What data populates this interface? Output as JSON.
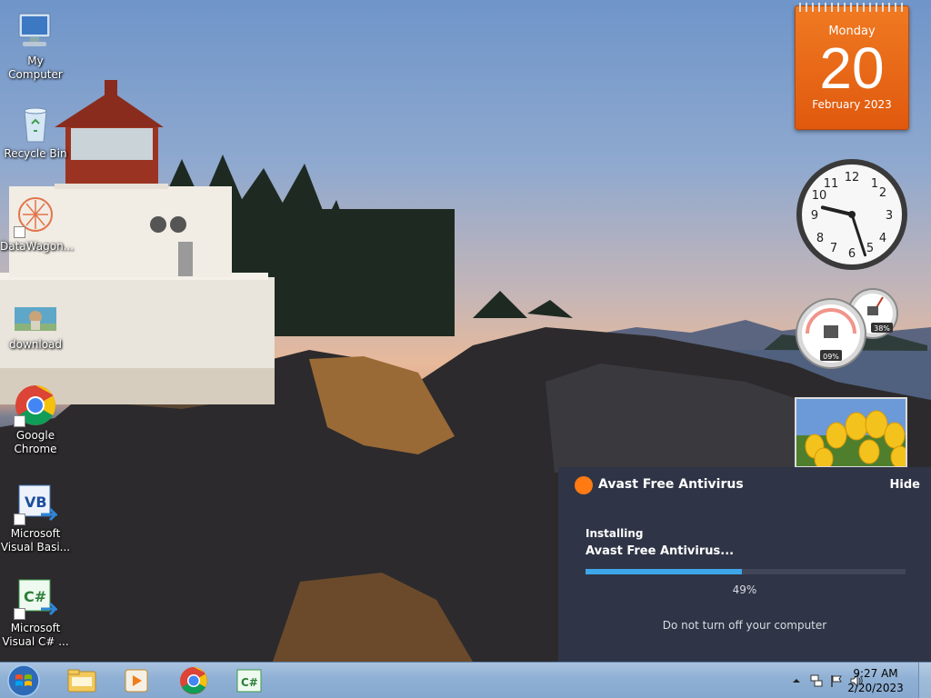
{
  "desktop_icons": [
    {
      "label": "My Computer"
    },
    {
      "label": "Recycle Bin"
    },
    {
      "label": "DataWagon..."
    },
    {
      "label": "download"
    },
    {
      "label": "Google\nChrome"
    },
    {
      "label": "Microsoft\nVisual Basi..."
    },
    {
      "label": "Microsoft\nVisual C# ..."
    }
  ],
  "calendar": {
    "weekday": "Monday",
    "day": "20",
    "month": "February 2023"
  },
  "clock_gadget": {
    "hour": 9,
    "minute": 27
  },
  "meter_gadget": {
    "cpu": "09%",
    "memory": "38%"
  },
  "avast": {
    "title": "Avast Free Antivirus",
    "hide_label": "Hide",
    "stage": "Installing",
    "product": "Avast Free Antivirus...",
    "progress": 0.49,
    "progress_label": "49%",
    "note": "Do not turn off your computer",
    "colors": {
      "bg": "#2f3446",
      "accent": "#3ea6e8",
      "brand": "#ff7a12"
    }
  },
  "taskbar": {
    "pinned": [
      "file-explorer",
      "windows-media-player",
      "google-chrome",
      "visual-csharp"
    ],
    "tray": {
      "time": "9:27 AM",
      "date": "2/20/2023"
    }
  }
}
